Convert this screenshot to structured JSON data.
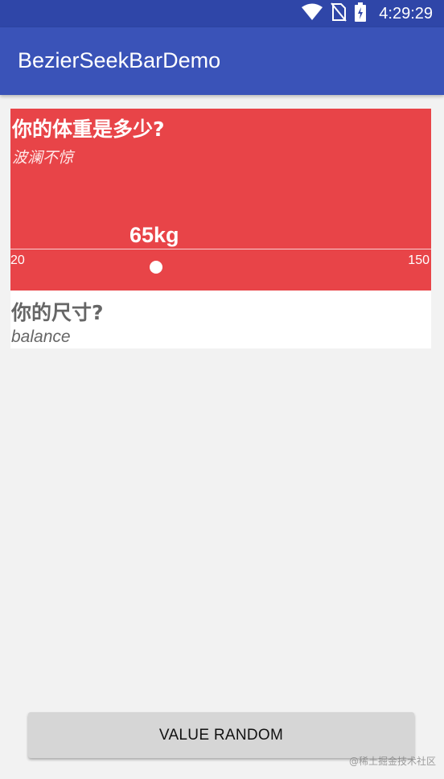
{
  "status_bar": {
    "time": "4:29:29",
    "icons": [
      "wifi-icon",
      "no-sim-icon",
      "battery-charging-icon"
    ]
  },
  "app_bar": {
    "title": "BezierSeekBarDemo",
    "color": "#3a53b8"
  },
  "seekbar_weight": {
    "question": "你的体重是多少?",
    "subtitle": "波澜不惊",
    "value_label": "65kg",
    "value": 65,
    "min_label": "20",
    "max_label": "150",
    "min": 20,
    "max": 150,
    "color": "#e84448"
  },
  "seekbar_size": {
    "question": "你的尺寸?",
    "subtitle": "balance"
  },
  "actions": {
    "random_button": "VALUE RANDOM"
  },
  "watermark": "@稀土掘金技术社区"
}
